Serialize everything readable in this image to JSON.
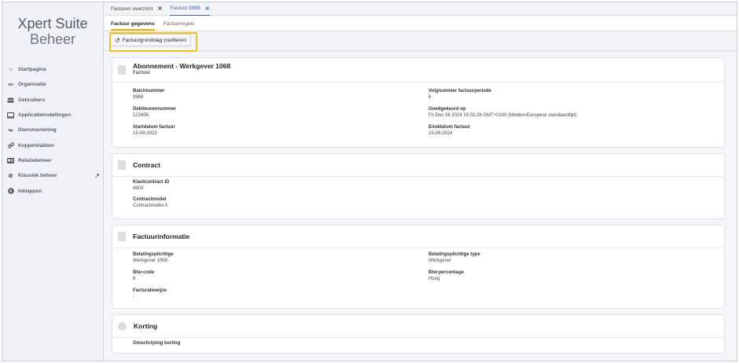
{
  "brand": {
    "line1": "Xpert Suite",
    "line2": "Beheer"
  },
  "sidebar": {
    "items": [
      {
        "label": "Startpagina",
        "icon": "home-icon",
        "glyph": "⌂"
      },
      {
        "label": "Organisatie",
        "icon": "org-icon",
        "glyph": "⚯"
      },
      {
        "label": "Gebruikers",
        "icon": "users-icon",
        "glyph": "👥"
      },
      {
        "label": "Applicatieinstellingen",
        "icon": "monitor-icon",
        "glyph": "▭"
      },
      {
        "label": "Dienstverlening",
        "icon": "handshake-icon",
        "glyph": "⇋"
      },
      {
        "label": "Koppelvlakken",
        "icon": "link-icon",
        "glyph": "⚭"
      },
      {
        "label": "Relatiebeheer",
        "icon": "idcard-icon",
        "glyph": "▤"
      },
      {
        "label": "Klassiek beheer",
        "icon": "gear-icon",
        "glyph": "⚙"
      },
      {
        "label": "Inklappen",
        "icon": "collapse-icon",
        "glyph": "◉"
      }
    ],
    "external_icon": "↗"
  },
  "doc_tabs": [
    {
      "label": "Facturen overzicht",
      "close": "✕"
    },
    {
      "label": "Factuur 9969",
      "close": "✕"
    }
  ],
  "sub_tabs": [
    "Factuur gegevens",
    "Factuurregels"
  ],
  "toolbar": {
    "credit_label": "Factuurgrondslag crediteren",
    "credit_icon": "↺"
  },
  "cards": {
    "abonnement": {
      "title": "Abonnement - Werkgever 1068",
      "subtitle": "Factuur",
      "fields": [
        {
          "label": "Batchnummer",
          "value": "9969"
        },
        {
          "label": "Volgnummer factuurperiode",
          "value": "6"
        },
        {
          "label": "Debiteurennummer",
          "value": "123456"
        },
        {
          "label": "Goedgekeurd op",
          "value": "Fri Dec 06 2024 15:03:28 GMT+0100 (Midden-Europese standaardtijd)"
        },
        {
          "label": "Startdatum factuur",
          "value": "15-09-2023"
        },
        {
          "label": "Einddatum factuur",
          "value": "15-09-2024"
        }
      ]
    },
    "contract": {
      "title": "Contract",
      "fields": [
        {
          "label": "Klantcontract ID",
          "value": "4903"
        },
        {
          "label": "Contractmodel",
          "value": "Contractmodel A"
        }
      ]
    },
    "factuurinformatie": {
      "title": "Factuurinformatie",
      "fields": [
        {
          "label": "Betalingsplichtige",
          "value": "Werkgever 1068"
        },
        {
          "label": "Betalingsplichtige type",
          "value": "Werkgever"
        },
        {
          "label": "Btw-code",
          "value": "6"
        },
        {
          "label": "Btw-percentage",
          "value": "Hoog"
        },
        {
          "label": "Facturatiewijze",
          "value": "-"
        }
      ]
    },
    "korting": {
      "title": "Korting",
      "fields": [
        {
          "label": "Omschrijving korting",
          "value": ""
        }
      ]
    }
  }
}
